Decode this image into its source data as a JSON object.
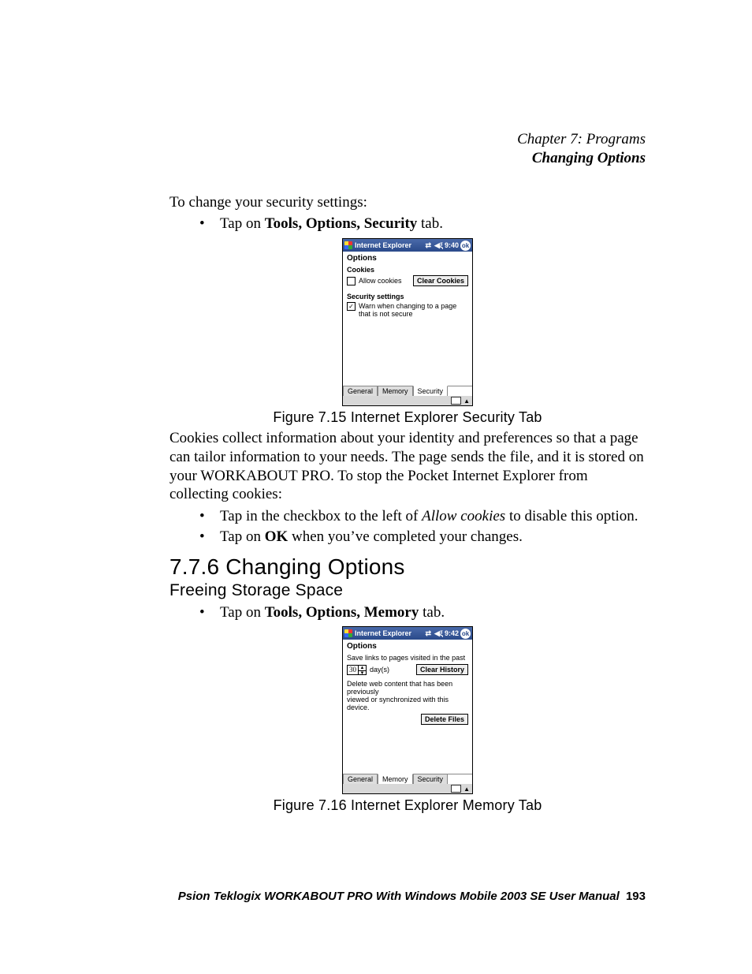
{
  "header": {
    "chapter": "Chapter 7: Programs",
    "section": "Changing Options"
  },
  "intro": "To change your security settings:",
  "bul1": {
    "pre": "Tap on ",
    "bold": "Tools, Options, Security",
    "post": " tab."
  },
  "shot1": {
    "titlebar": {
      "app": "Internet Explorer",
      "time": "9:40",
      "ok": "ok"
    },
    "options": "Options",
    "cookies_hdr": "Cookies",
    "allow": "Allow cookies",
    "clear": "Clear Cookies",
    "sec_hdr": "Security settings",
    "warn1": "Warn when changing to a page",
    "warn2": "that is not secure",
    "tabs": {
      "general": "General",
      "memory": "Memory",
      "security": "Security"
    }
  },
  "cap1": "Figure 7.15 Internet Explorer Security Tab",
  "para1": "Cookies collect information about your identity and preferences so that a page can tailor information to your needs. The page sends the file, and it is stored on your WORKABOUT PRO. To stop the Pocket Internet Explorer from collecting cookies:",
  "bul2a": {
    "pre": "Tap in the checkbox to the left of ",
    "ital": "Allow cookies",
    "post": " to disable this option."
  },
  "bul2b": {
    "pre": "Tap on ",
    "bold": "OK",
    "post": " when you’ve completed your changes."
  },
  "h2": "7.7.6  Changing Options",
  "h3": "Freeing Storage Space",
  "bul3": {
    "pre": "Tap on ",
    "bold": "Tools, Options, Memory",
    "post": " tab."
  },
  "shot2": {
    "titlebar": {
      "app": "Internet Explorer",
      "time": "9:42",
      "ok": "ok"
    },
    "options": "Options",
    "line1": "Save links to pages visited in the past",
    "spin_val": "30",
    "days": "day(s)",
    "clear_hist": "Clear History",
    "line2a": "Delete web content that has been previously",
    "line2b": "viewed or synchronized with this device.",
    "delete_files": "Delete Files",
    "tabs": {
      "general": "General",
      "memory": "Memory",
      "security": "Security"
    }
  },
  "cap2": "Figure 7.16 Internet Explorer Memory Tab",
  "footer": {
    "book": "Psion Teklogix WORKABOUT PRO With Windows Mobile 2003 SE User Manual",
    "page": "193"
  }
}
